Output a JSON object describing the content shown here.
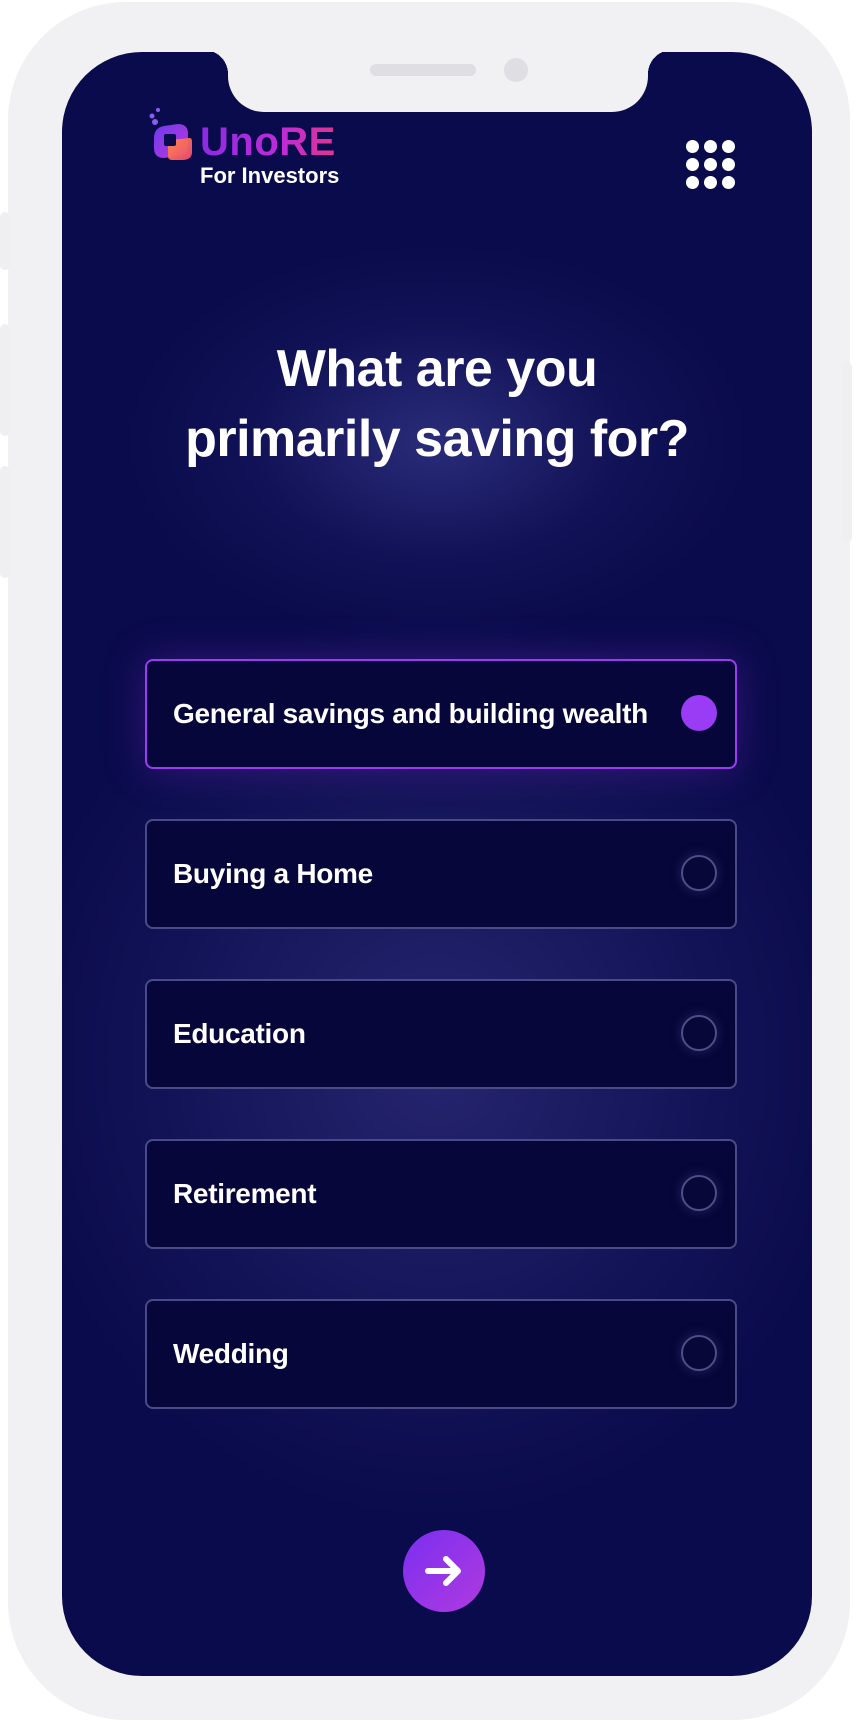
{
  "brand": {
    "name": "UnoRE",
    "subtitle": "For Investors"
  },
  "question": {
    "line1": "What are you",
    "line2": "primarily saving for?"
  },
  "options": [
    {
      "label": "General savings and building wealth",
      "selected": true
    },
    {
      "label": "Buying a Home",
      "selected": false
    },
    {
      "label": "Education",
      "selected": false
    },
    {
      "label": "Retirement",
      "selected": false
    },
    {
      "label": "Wedding",
      "selected": false
    }
  ],
  "icons": {
    "menu": "grid-dots-icon",
    "next": "arrow-right-icon",
    "logo": "unore-logo-icon"
  },
  "colors": {
    "background": "#0a0b4c",
    "accent": "#9a3cf5",
    "card": "#06063a",
    "card_border": "#4a4b86"
  }
}
